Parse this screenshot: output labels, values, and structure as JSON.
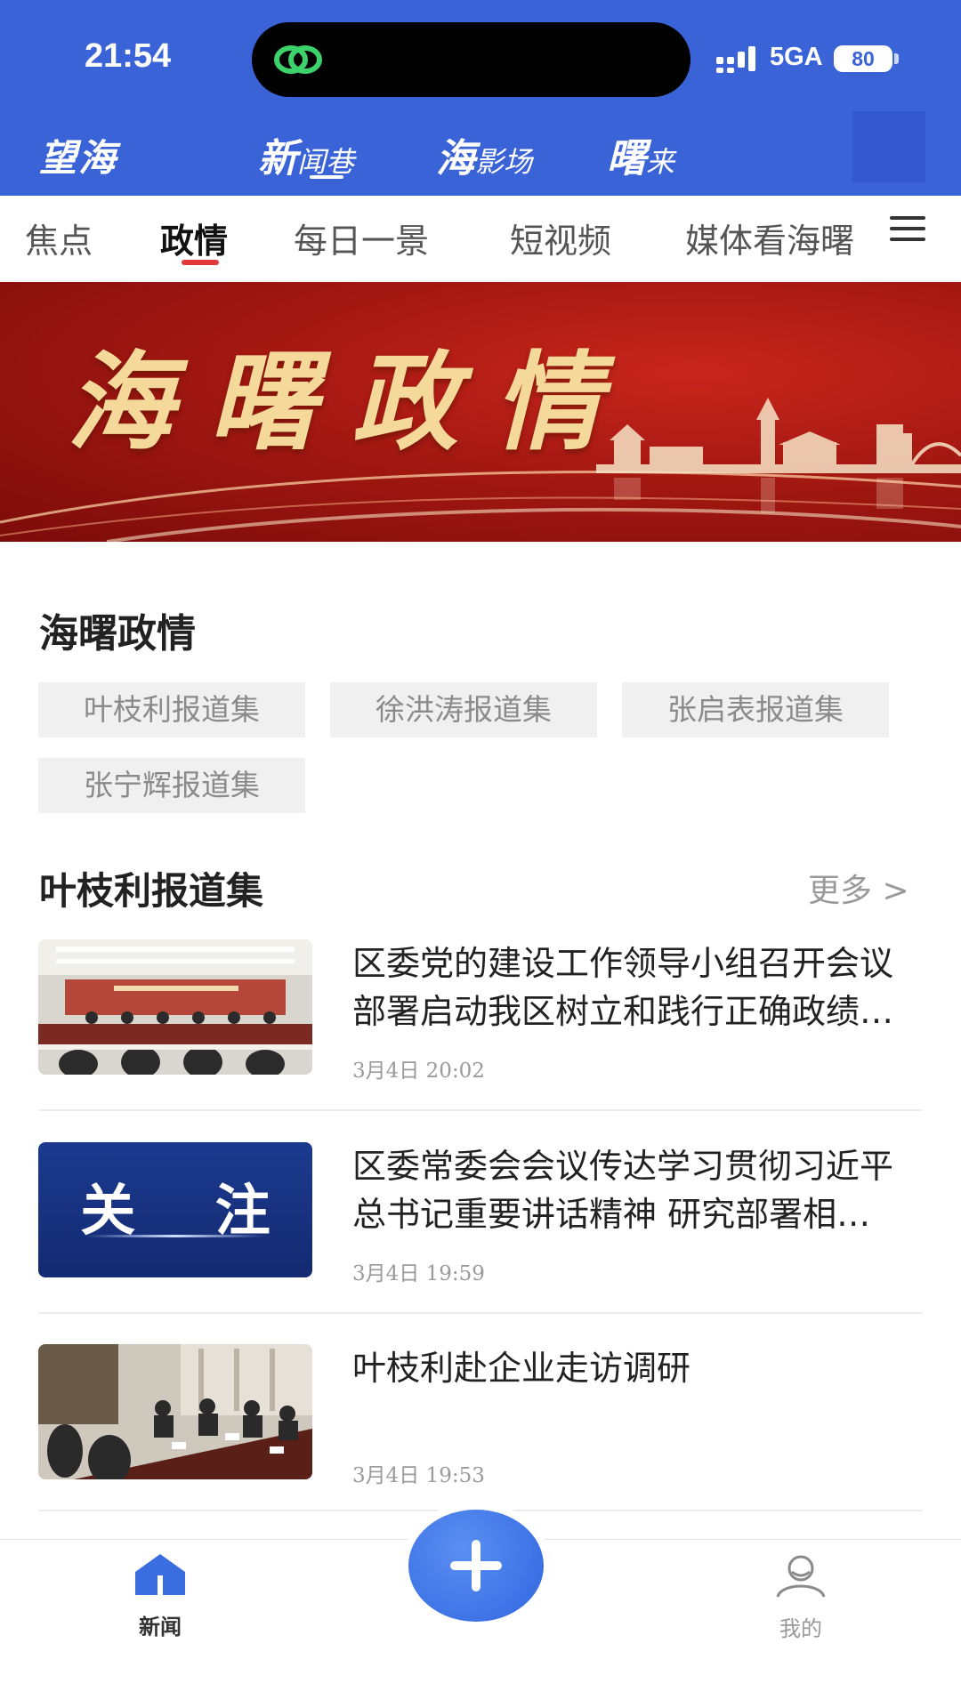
{
  "status_bar": {
    "time": "21:54",
    "network": "5GA",
    "battery": "80"
  },
  "brand": {
    "logo_text": "望海"
  },
  "top_nav": {
    "items": [
      {
        "big": "新",
        "small": "闻巷"
      },
      {
        "big": "海",
        "small": "影场"
      },
      {
        "big": "曙",
        "small": "来"
      }
    ]
  },
  "tabs": [
    "焦点",
    "政情",
    "每日一景",
    "短视频",
    "媒体看海曙"
  ],
  "tabs_active_index": 1,
  "banner": {
    "title": "海曙政情"
  },
  "section": {
    "title": "海曙政情",
    "chips": [
      "叶枝利报道集",
      "徐洪涛报道集",
      "张启表报道集",
      "张宁辉报道集"
    ]
  },
  "subsection": {
    "title": "叶枝利报道集",
    "more": "更多 >"
  },
  "news": [
    {
      "title": "区委党的建设工作领导小组召开会议 部署启动我区树立和践行正确政绩观学习教育",
      "time": "3月4日 20:02"
    },
    {
      "title": "区委常委会会议传达学习贯彻习近平总书记重要讲话精神 研究部署相关工作",
      "time": "3月4日 19:59",
      "thumb_text": "关 注"
    },
    {
      "title": "叶枝利赴企业走访调研",
      "time": "3月4日 19:53"
    }
  ],
  "bottom_bar": {
    "news_label": "新闻",
    "me_label": "我的"
  },
  "colors": {
    "header_blue": "#3a63d8",
    "accent_red": "#e23a3a",
    "fab_blue": "#2f66e0"
  }
}
